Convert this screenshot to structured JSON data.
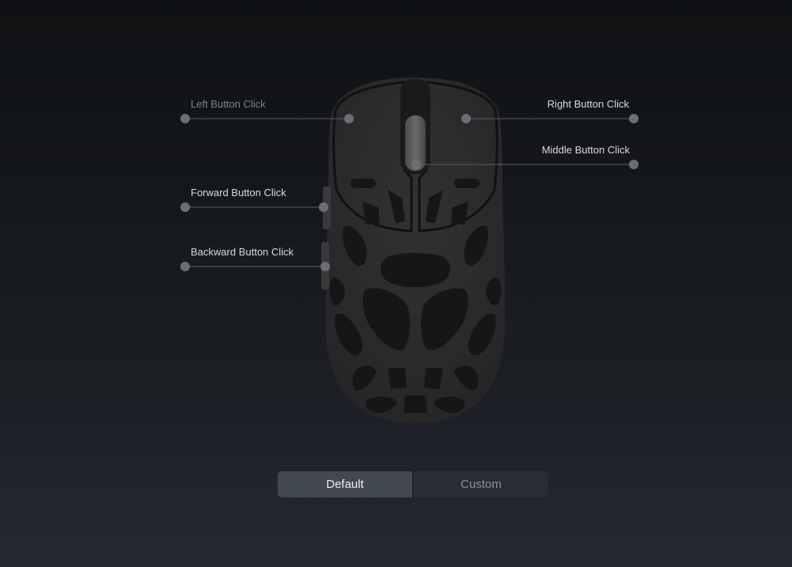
{
  "callouts": {
    "left": "Left Button Click",
    "right": "Right Button Click",
    "middle": "Middle Button Click",
    "forward": "Forward Button Click",
    "backward": "Backward Button Click"
  },
  "mode_toggle": {
    "options": [
      "Default",
      "Custom"
    ],
    "selected": "Default"
  },
  "colors": {
    "accent_label": "#d8dadd",
    "dim_label": "#7d8186",
    "node": "#6b6f74",
    "line": "#5a5e63",
    "mouse_shell": "#2b2b2d",
    "mouse_holes": "#161617",
    "active_tab": "#434950"
  }
}
